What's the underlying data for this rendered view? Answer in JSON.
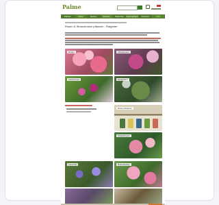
{
  "site": {
    "logo": "Palmen",
    "nav": [
      "Palmen",
      "Kübel",
      "Exoten",
      "Stauden",
      "Sträucher",
      "Gartenpflanzen",
      "Zubehör",
      "Info"
    ],
    "title": "Rosen & Strauchrosen pflanzen - Ratgeber"
  },
  "tiles": [
    {
      "label": "Rosen"
    },
    {
      "label": "Pfingstrosen"
    },
    {
      "label": "Kletterrosen"
    },
    {
      "label": "Hortensien"
    },
    {
      "label": "Rosen Zubehör"
    },
    {
      "label": "Strauchrosen"
    },
    {
      "label": "Lavendel"
    },
    {
      "label": "Bodendecker"
    }
  ],
  "colors": {
    "nav": "#4f7a2a",
    "accent_red": "#c9695a",
    "cta": "#d9742a"
  }
}
